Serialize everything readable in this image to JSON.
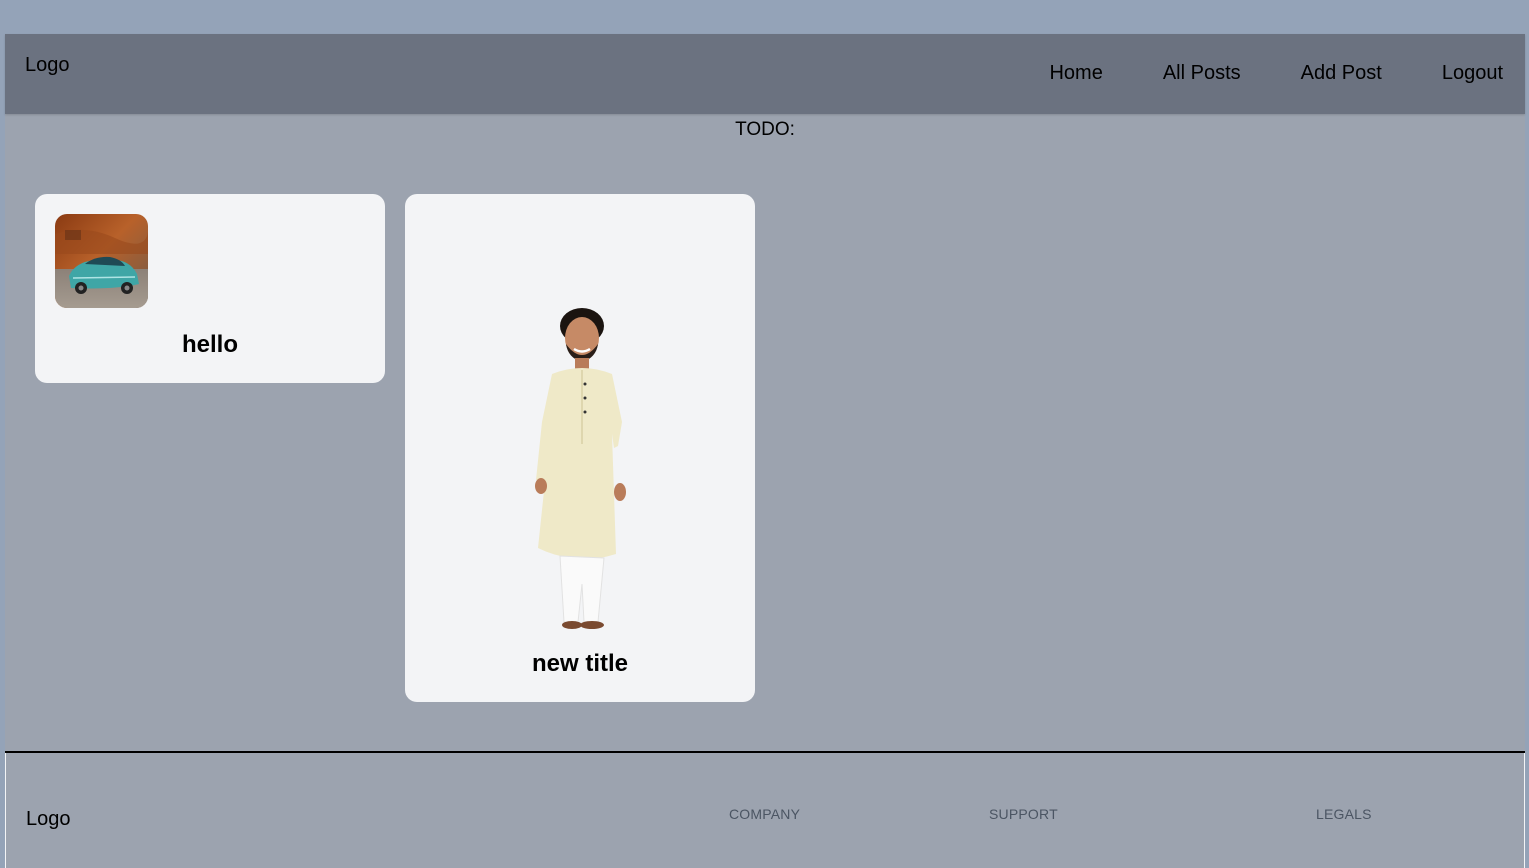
{
  "header": {
    "logo": "Logo",
    "nav": [
      "Home",
      "All Posts",
      "Add Post",
      "Logout"
    ]
  },
  "main": {
    "todo": "TODO:",
    "posts": [
      {
        "title": "hello",
        "image": "teal-sports-car"
      },
      {
        "title": "new title",
        "image": "man-in-kurta"
      }
    ]
  },
  "footer": {
    "logo": "Logo",
    "headings": [
      "COMPANY",
      "SUPPORT",
      "LEGALS"
    ]
  },
  "colors": {
    "page_bg": "#94a3b8",
    "content_bg": "#9ca3af",
    "header_bg": "#6b7280",
    "card_bg": "#f3f4f6"
  }
}
